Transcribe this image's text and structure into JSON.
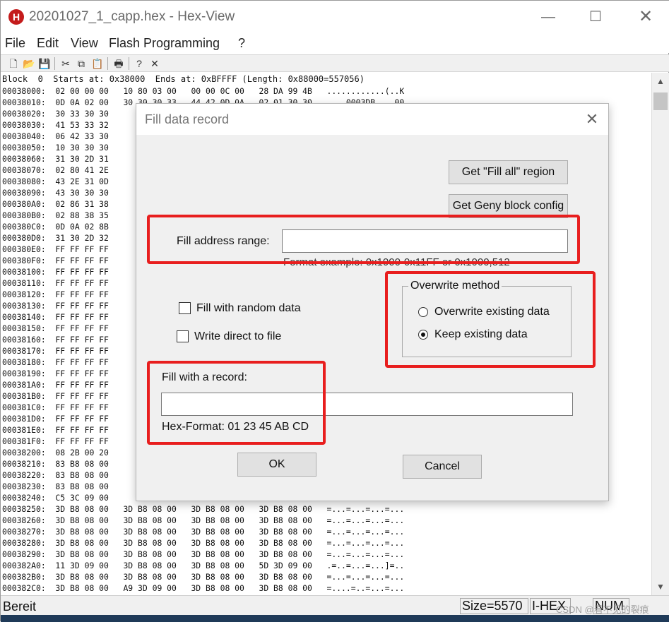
{
  "window": {
    "icon_letter": "H",
    "title": "20201027_1_capp.hex - Hex-View",
    "minimize": "—",
    "maximize": "☐",
    "close": "✕"
  },
  "menu": [
    "File",
    "Edit",
    "View",
    "Flash Programming",
    "?"
  ],
  "toolbar": {
    "icons": [
      "new-file-icon",
      "open-folder-icon",
      "save-icon",
      "cut-icon",
      "copy-icon",
      "paste-icon",
      "print-icon",
      "help-icon",
      "close-icon"
    ],
    "glyphs": [
      "🗋",
      "📂",
      "💾",
      "✂",
      "⧉",
      "📋",
      "🖶",
      "?",
      "✕"
    ]
  },
  "hex_view": {
    "block_header": "Block  0  Starts at: 0x38000  Ends at: 0xBFFFF (Length: 0x88000=557056)",
    "lines": [
      "00038000:  02 00 00 00   10 80 03 00   00 00 0C 00   28 DA 99 4B   ............(..K",
      "00038010:  0D 0A 02 00   30 30 30 33   44 42 0D 0A   02 01 30 30   ....0003DB....00",
      "00038020:  30 33 30 30",
      "00038030:  41 53 33 32",
      "00038040:  06 42 33 30",
      "00038050:  10 30 30 30",
      "00038060:  31 30 2D 31",
      "00038070:  02 80 41 2E",
      "00038080:  43 2E 31 0D",
      "00038090:  43 30 30 30",
      "000380A0:  02 86 31 38",
      "000380B0:  02 88 38 35",
      "000380C0:  0D 0A 02 8B",
      "000380D0:  31 30 2D 32",
      "000380E0:  FF FF FF FF",
      "000380F0:  FF FF FF FF",
      "00038100:  FF FF FF FF",
      "00038110:  FF FF FF FF",
      "00038120:  FF FF FF FF",
      "00038130:  FF FF FF FF",
      "00038140:  FF FF FF FF",
      "00038150:  FF FF FF FF",
      "00038160:  FF FF FF FF",
      "00038170:  FF FF FF FF",
      "00038180:  FF FF FF FF",
      "00038190:  FF FF FF FF",
      "000381A0:  FF FF FF FF",
      "000381B0:  FF FF FF FF",
      "000381C0:  FF FF FF FF",
      "000381D0:  FF FF FF FF",
      "000381E0:  FF FF FF FF",
      "000381F0:  FF FF FF FF",
      "00038200:  08 2B 00 20",
      "00038210:  83 B8 08 00",
      "00038220:  83 B8 08 00",
      "00038230:  83 B8 08 00",
      "00038240:  C5 3C 09 00",
      "00038250:  3D B8 08 00   3D B8 08 00   3D B8 08 00   3D B8 08 00   =...=...=...=...",
      "00038260:  3D B8 08 00   3D B8 08 00   3D B8 08 00   3D B8 08 00   =...=...=...=...",
      "00038270:  3D B8 08 00   3D B8 08 00   3D B8 08 00   3D B8 08 00   =...=...=...=...",
      "00038280:  3D B8 08 00   3D B8 08 00   3D B8 08 00   3D B8 08 00   =...=...=...=...",
      "00038290:  3D B8 08 00   3D B8 08 00   3D B8 08 00   3D B8 08 00   =...=...=...=...",
      "000382A0:  11 3D 09 00   3D B8 08 00   3D B8 08 00   5D 3D 09 00   .=..=...=...]=..",
      "000382B0:  3D B8 08 00   3D B8 08 00   3D B8 08 00   3D B8 08 00   =...=...=...=...",
      "000382C0:  3D B8 08 00   A9 3D 09 00   3D B8 08 00   3D B8 08 00   =....=..=...=..."
    ]
  },
  "status_bar": {
    "text": "Bereit",
    "size": "Size=5570",
    "format": "I-HEX",
    "num": "NUM",
    "watermark": "CSDN @看不见的裂痕"
  },
  "dialog": {
    "title": "Fill data record",
    "close": "✕",
    "get_fill_all_button": "Get \"Fill all\" region",
    "get_geny_button": "Get Geny block config",
    "fill_address_label": "Fill address range:",
    "fill_address_value": "",
    "format_example": "Format example: 0x1000-0x11FF or 0x1000,512",
    "fill_random_label": "Fill with random data",
    "write_direct_label": "Write direct to file",
    "overwrite_method_legend": "Overwrite method",
    "overwrite_existing_label": "Overwrite existing data",
    "keep_existing_label": "Keep existing data",
    "fill_record_label": "Fill with a record:",
    "fill_record_value": "",
    "hex_format_label": "Hex-Format:  01 23 45 AB CD",
    "ok_button": "OK",
    "cancel_button": "Cancel"
  },
  "colors": {
    "highlight": "#e81e1e",
    "app_icon": "#c41b1b",
    "dialog_bg": "#f0f0f0"
  }
}
